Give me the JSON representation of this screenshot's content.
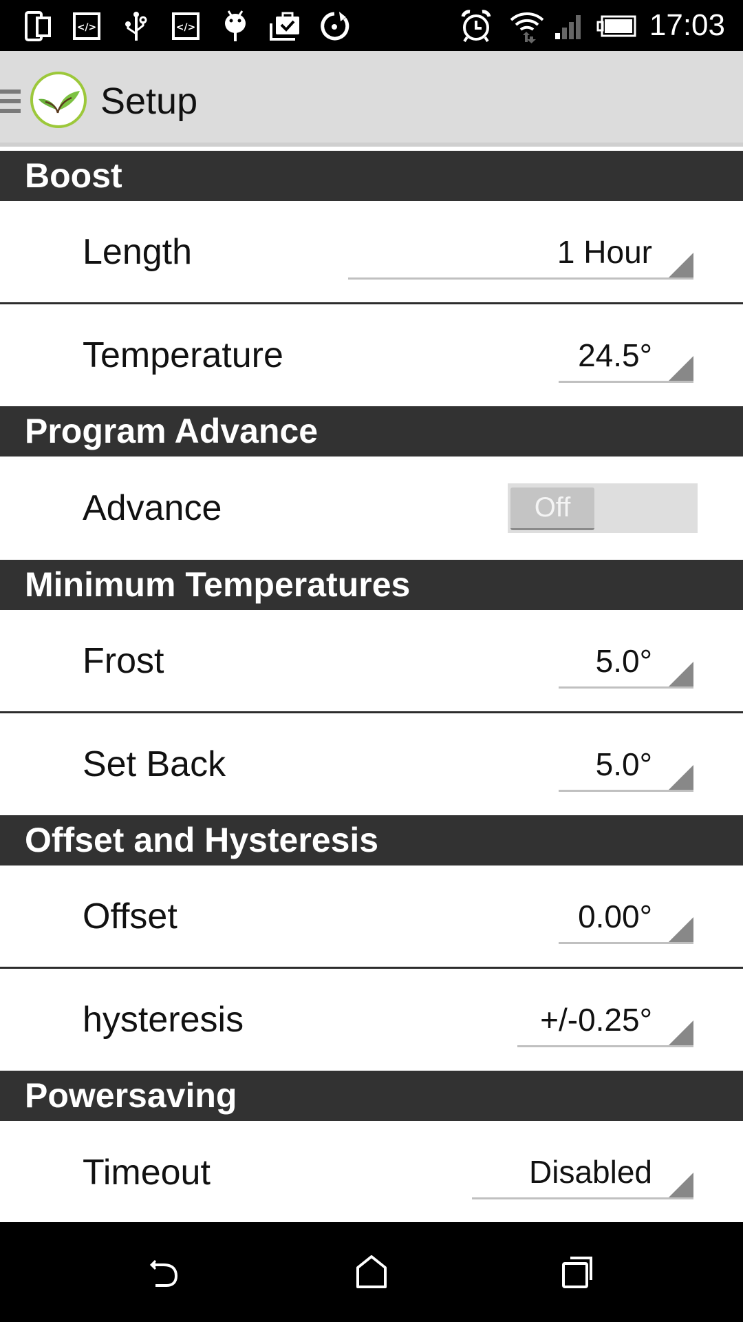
{
  "status_bar": {
    "time": "17:03",
    "left_icons": [
      "device-switch-icon",
      "code-icon",
      "usb-icon",
      "code-icon",
      "android-debug-icon",
      "briefcase-check-icon",
      "sync-icon"
    ],
    "right_icons": [
      "alarm-icon",
      "wifi-icon",
      "cell-signal-icon",
      "battery-icon"
    ]
  },
  "app_bar": {
    "title": "Setup",
    "logo": "leaf-logo"
  },
  "sections": [
    {
      "title": "Boost",
      "rows": [
        {
          "label": "Length",
          "value": "1 Hour",
          "type": "spinner"
        },
        {
          "label": "Temperature",
          "value": "24.5°",
          "type": "spinner"
        }
      ]
    },
    {
      "title": "Program Advance",
      "rows": [
        {
          "label": "Advance",
          "value": "Off",
          "type": "toggle",
          "checked": false
        }
      ]
    },
    {
      "title": "Minimum Temperatures",
      "rows": [
        {
          "label": "Frost",
          "value": "5.0°",
          "type": "spinner"
        },
        {
          "label": "Set Back",
          "value": "5.0°",
          "type": "spinner"
        }
      ]
    },
    {
      "title": "Offset and Hysteresis",
      "rows": [
        {
          "label": "Offset",
          "value": "0.00°",
          "type": "spinner"
        },
        {
          "label": "hysteresis",
          "value": "+/-0.25°",
          "type": "spinner"
        }
      ]
    },
    {
      "title": "Powersaving",
      "rows": [
        {
          "label": "Timeout",
          "value": "Disabled",
          "type": "spinner"
        }
      ]
    }
  ],
  "nav_bar": {
    "buttons": [
      "back",
      "home",
      "recents"
    ]
  },
  "colors": {
    "section_header_bg": "#323232",
    "app_bar_bg": "#dcdcdc",
    "logo_ring": "#9cc83a",
    "leaf_green": "#6ab23c"
  }
}
